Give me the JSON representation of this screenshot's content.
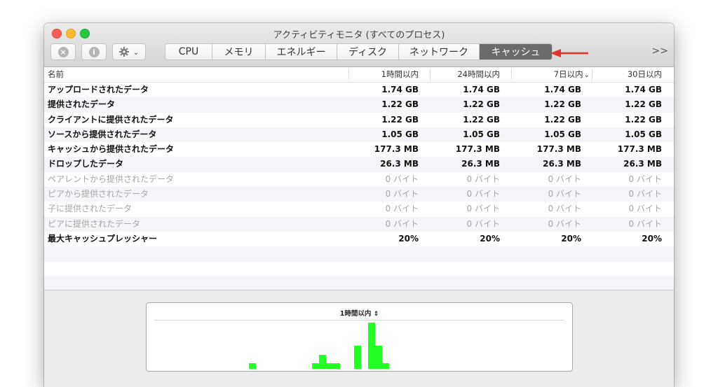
{
  "window": {
    "title": "アクティビティモニタ (すべてのプロセス)"
  },
  "toolbar": {
    "stop_icon": "stop-process-icon",
    "info_icon": "info-icon",
    "gear_icon": "gear-icon",
    "gear_menu_chevron": "⌄",
    "overflow_label": ">>",
    "tabs": [
      {
        "label": "CPU",
        "active": false
      },
      {
        "label": "メモリ",
        "active": false
      },
      {
        "label": "エネルギー",
        "active": false
      },
      {
        "label": "ディスク",
        "active": false
      },
      {
        "label": "ネットワーク",
        "active": false
      },
      {
        "label": "キャッシュ",
        "active": true
      }
    ]
  },
  "annotation": {
    "arrow_color": "#e8322a"
  },
  "table": {
    "columns": [
      "名前",
      "1時間以内",
      "24時間以内",
      "7日以内",
      "30日以内"
    ],
    "sort_indicator": "⌄",
    "rows": [
      {
        "name": "アップロードされたデータ",
        "values": [
          "1.74 GB",
          "1.74 GB",
          "1.74 GB",
          "1.74 GB"
        ],
        "dim": false
      },
      {
        "name": "提供されたデータ",
        "values": [
          "1.22 GB",
          "1.22 GB",
          "1.22 GB",
          "1.22 GB"
        ],
        "dim": false
      },
      {
        "name": "クライアントに提供されたデータ",
        "values": [
          "1.22 GB",
          "1.22 GB",
          "1.22 GB",
          "1.22 GB"
        ],
        "dim": false
      },
      {
        "name": "ソースから提供されたデータ",
        "values": [
          "1.05 GB",
          "1.05 GB",
          "1.05 GB",
          "1.05 GB"
        ],
        "dim": false
      },
      {
        "name": "キャッシュから提供されたデータ",
        "values": [
          "177.3 MB",
          "177.3 MB",
          "177.3 MB",
          "177.3 MB"
        ],
        "dim": false
      },
      {
        "name": "ドロップしたデータ",
        "values": [
          "26.3 MB",
          "26.3 MB",
          "26.3 MB",
          "26.3 MB"
        ],
        "dim": false
      },
      {
        "name": "ペアレントから提供されたデータ",
        "values": [
          "0 バイト",
          "0 バイト",
          "0 バイト",
          "0 バイト"
        ],
        "dim": true
      },
      {
        "name": "ピアから提供されたデータ",
        "values": [
          "0 バイト",
          "0 バイト",
          "0 バイト",
          "0 バイト"
        ],
        "dim": true
      },
      {
        "name": "子に提供されたデータ",
        "values": [
          "0 バイト",
          "0 バイト",
          "0 バイト",
          "0 バイト"
        ],
        "dim": true
      },
      {
        "name": "ピアに提供されたデータ",
        "values": [
          "0 バイト",
          "0 バイト",
          "0 バイト",
          "0 バイト"
        ],
        "dim": true
      },
      {
        "name": "最大キャッシュプレッシャー",
        "values": [
          "20%",
          "20%",
          "20%",
          "20%"
        ],
        "dim": false
      },
      {
        "name": "",
        "values": [
          "",
          "",
          "",
          ""
        ],
        "dim": false
      },
      {
        "name": "",
        "values": [
          "",
          "",
          "",
          ""
        ],
        "dim": false
      },
      {
        "name": "",
        "values": [
          "",
          "",
          "",
          ""
        ],
        "dim": false
      }
    ]
  },
  "graph": {
    "range_label": "1時間以内",
    "range_stepper": "⇕",
    "bar_color": "#22ff22"
  },
  "chart_data": {
    "type": "bar",
    "title": "1時間以内",
    "bars": [
      {
        "slot": 0,
        "level": 0.12
      },
      {
        "slot": 9,
        "level": 0.12
      },
      {
        "slot": 10,
        "level": 0.3
      },
      {
        "slot": 11,
        "level": 0.12
      },
      {
        "slot": 12,
        "level": 0.12
      },
      {
        "slot": 15,
        "level": 0.5
      },
      {
        "slot": 17,
        "level": 1.0
      },
      {
        "slot": 18,
        "level": 0.5
      },
      {
        "slot": 19,
        "level": 0.12
      }
    ]
  }
}
